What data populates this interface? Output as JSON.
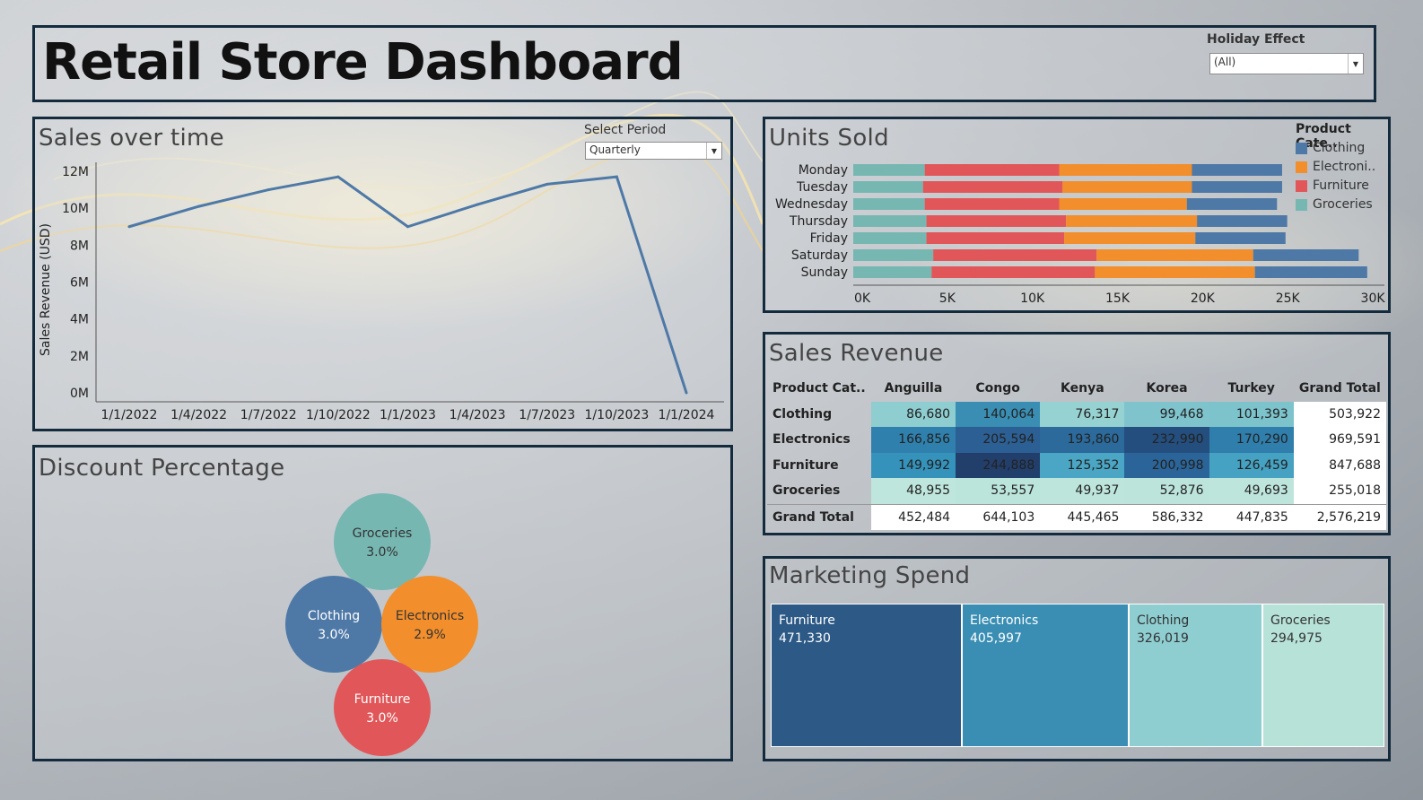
{
  "title": "Retail Store Dashboard",
  "holiday_filter": {
    "label": "Holiday Effect",
    "value": "(All)"
  },
  "sales_over_time": {
    "title": "Sales over time",
    "period_filter": {
      "label": "Select Period",
      "value": "Quarterly"
    }
  },
  "units_sold": {
    "title": "Units Sold",
    "legend_title": "Product Cate..",
    "legend": [
      {
        "name": "Clothing",
        "color": "#4e79a7"
      },
      {
        "name": "Electroni..",
        "color": "#f28e2b"
      },
      {
        "name": "Furniture",
        "color": "#e15759"
      },
      {
        "name": "Groceries",
        "color": "#76b7b2"
      }
    ]
  },
  "discount": {
    "title": "Discount Percentage",
    "bubbles": [
      {
        "name": "Groceries",
        "value": "3.0%",
        "color": "#76b7b2"
      },
      {
        "name": "Clothing",
        "value": "3.0%",
        "color": "#4e79a7"
      },
      {
        "name": "Electronics",
        "value": "2.9%",
        "color": "#f28e2b"
      },
      {
        "name": "Furniture",
        "value": "3.0%",
        "color": "#e15759"
      }
    ]
  },
  "sales_revenue": {
    "title": "Sales Revenue",
    "headers": [
      "Product Cat..",
      "Anguilla",
      "Congo",
      "Kenya",
      "Korea",
      "Turkey",
      "Grand Total"
    ],
    "rows": [
      {
        "label": "Clothing",
        "cells": [
          "86,680",
          "140,064",
          "76,317",
          "99,468",
          "101,393"
        ],
        "total": "503,922"
      },
      {
        "label": "Electronics",
        "cells": [
          "166,856",
          "205,594",
          "193,860",
          "232,990",
          "170,290"
        ],
        "total": "969,591"
      },
      {
        "label": "Furniture",
        "cells": [
          "149,992",
          "244,888",
          "125,352",
          "200,998",
          "126,459"
        ],
        "total": "847,688"
      },
      {
        "label": "Groceries",
        "cells": [
          "48,955",
          "53,557",
          "49,937",
          "52,876",
          "49,693"
        ],
        "total": "255,018"
      }
    ],
    "grand_total": {
      "label": "Grand Total",
      "cells": [
        "452,484",
        "644,103",
        "445,465",
        "586,332",
        "447,835"
      ],
      "total": "2,576,219"
    }
  },
  "marketing_spend": {
    "title": "Marketing Spend",
    "items": [
      {
        "name": "Furniture",
        "value": "471,330",
        "color": "#2c5985"
      },
      {
        "name": "Electronics",
        "value": "405,997",
        "color": "#3a8eb3"
      },
      {
        "name": "Clothing",
        "value": "326,019",
        "color": "#8ecdd0"
      },
      {
        "name": "Groceries",
        "value": "294,975",
        "color": "#b7e2d8"
      }
    ]
  },
  "chart_data": [
    {
      "type": "line",
      "title": "Sales over time",
      "ylabel": "Sales Revenue (USD)",
      "x": [
        "1/1/2022",
        "1/4/2022",
        "1/7/2022",
        "1/10/2022",
        "1/1/2023",
        "1/4/2023",
        "1/7/2023",
        "1/10/2023",
        "1/1/2024"
      ],
      "values": [
        9.0,
        10.1,
        11.0,
        11.7,
        9.0,
        10.2,
        11.3,
        11.7,
        0.0
      ],
      "y_unit": "M",
      "yticks": [
        "0M",
        "2M",
        "4M",
        "6M",
        "8M",
        "10M",
        "12M"
      ],
      "ylim": [
        0,
        12
      ]
    },
    {
      "type": "bar",
      "orientation": "horizontal-stacked",
      "title": "Units Sold",
      "categories": [
        "Monday",
        "Tuesday",
        "Wednesday",
        "Thursday",
        "Friday",
        "Saturday",
        "Sunday"
      ],
      "series": [
        {
          "name": "Groceries",
          "values": [
            4200,
            4100,
            4200,
            4300,
            4300,
            4700,
            4600
          ]
        },
        {
          "name": "Furniture",
          "values": [
            7900,
            8200,
            7900,
            8200,
            8100,
            9600,
            9600
          ]
        },
        {
          "name": "Electronics",
          "values": [
            7800,
            7600,
            7500,
            7700,
            7700,
            9200,
            9400
          ]
        },
        {
          "name": "Clothing",
          "values": [
            5300,
            5300,
            5300,
            5300,
            5300,
            6200,
            6600
          ]
        }
      ],
      "xticks": [
        "0K",
        "5K",
        "10K",
        "15K",
        "20K",
        "25K",
        "30K"
      ],
      "xlim": [
        0,
        31000
      ]
    }
  ]
}
